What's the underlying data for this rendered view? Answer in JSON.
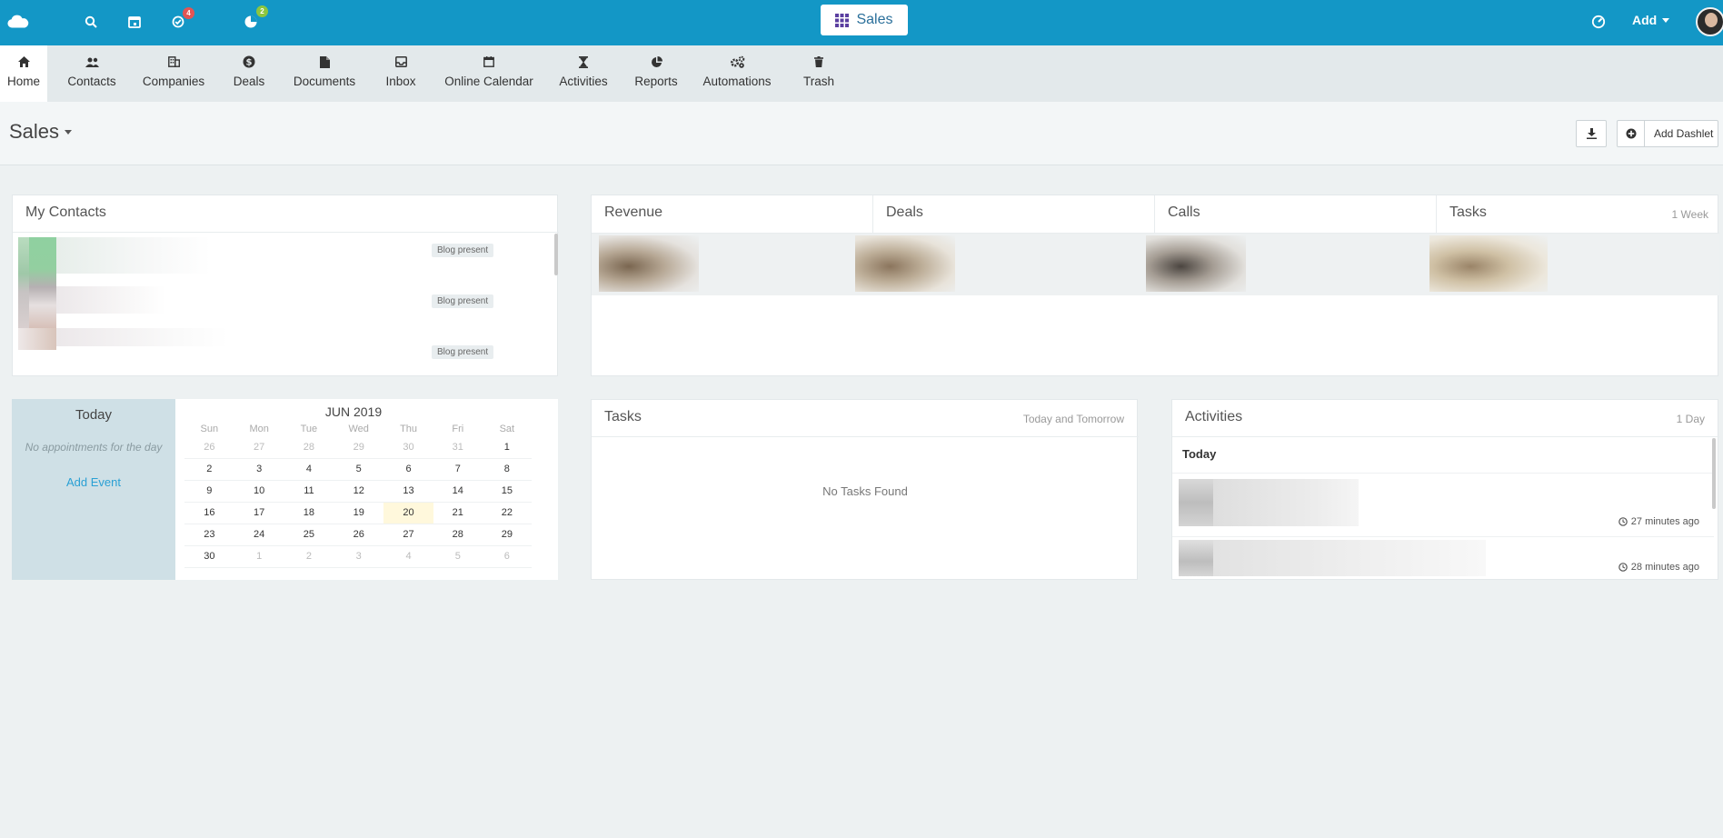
{
  "topbar": {
    "app_name": "Sales",
    "add_label": "Add",
    "badges": {
      "tasks": "4",
      "deals": "2"
    },
    "colors": {
      "bg": "#1397c6",
      "badge_red": "#e25454",
      "badge_green": "#8cc63f"
    }
  },
  "nav": {
    "items": [
      {
        "label": "Home",
        "icon": "home-icon"
      },
      {
        "label": "Contacts",
        "icon": "contacts-icon"
      },
      {
        "label": "Companies",
        "icon": "building-icon"
      },
      {
        "label": "Deals",
        "icon": "dollar-icon"
      },
      {
        "label": "Documents",
        "icon": "document-icon"
      },
      {
        "label": "Inbox",
        "icon": "inbox-icon"
      },
      {
        "label": "Online Calendar",
        "icon": "calendar-icon"
      },
      {
        "label": "Activities",
        "icon": "hourglass-icon"
      },
      {
        "label": "Reports",
        "icon": "pie-chart-icon"
      },
      {
        "label": "Automations",
        "icon": "gears-icon"
      },
      {
        "label": "Trash",
        "icon": "trash-icon"
      }
    ],
    "active": "Home"
  },
  "header": {
    "title": "Sales",
    "add_dashlet": "Add Dashlet"
  },
  "my_contacts": {
    "title": "My Contacts",
    "rows": [
      {
        "tag": "Blog present"
      },
      {
        "tag": "Blog present"
      },
      {
        "tag": "Blog present"
      }
    ]
  },
  "stats": {
    "tabs": [
      "Revenue",
      "Deals",
      "Calls",
      "Tasks"
    ],
    "period": "1 Week"
  },
  "calendar": {
    "today_label": "Today",
    "no_appointments": "No appointments for the day",
    "add_event": "Add Event",
    "month": "JUN 2019",
    "weekdays": [
      "Sun",
      "Mon",
      "Tue",
      "Wed",
      "Thu",
      "Fri",
      "Sat"
    ],
    "weeks": [
      [
        "26",
        "27",
        "28",
        "29",
        "30",
        "31",
        "1"
      ],
      [
        "2",
        "3",
        "4",
        "5",
        "6",
        "7",
        "8"
      ],
      [
        "9",
        "10",
        "11",
        "12",
        "13",
        "14",
        "15"
      ],
      [
        "16",
        "17",
        "18",
        "19",
        "20",
        "21",
        "22"
      ],
      [
        "23",
        "24",
        "25",
        "26",
        "27",
        "28",
        "29"
      ],
      [
        "30",
        "1",
        "2",
        "3",
        "4",
        "5",
        "6"
      ]
    ],
    "today": "20"
  },
  "tasks": {
    "title": "Tasks",
    "range": "Today and Tomorrow",
    "empty": "No Tasks Found"
  },
  "activities": {
    "title": "Activities",
    "range": "1 Day",
    "group": "Today",
    "items": [
      {
        "time": "27 minutes ago"
      },
      {
        "time": "28 minutes ago"
      }
    ]
  }
}
